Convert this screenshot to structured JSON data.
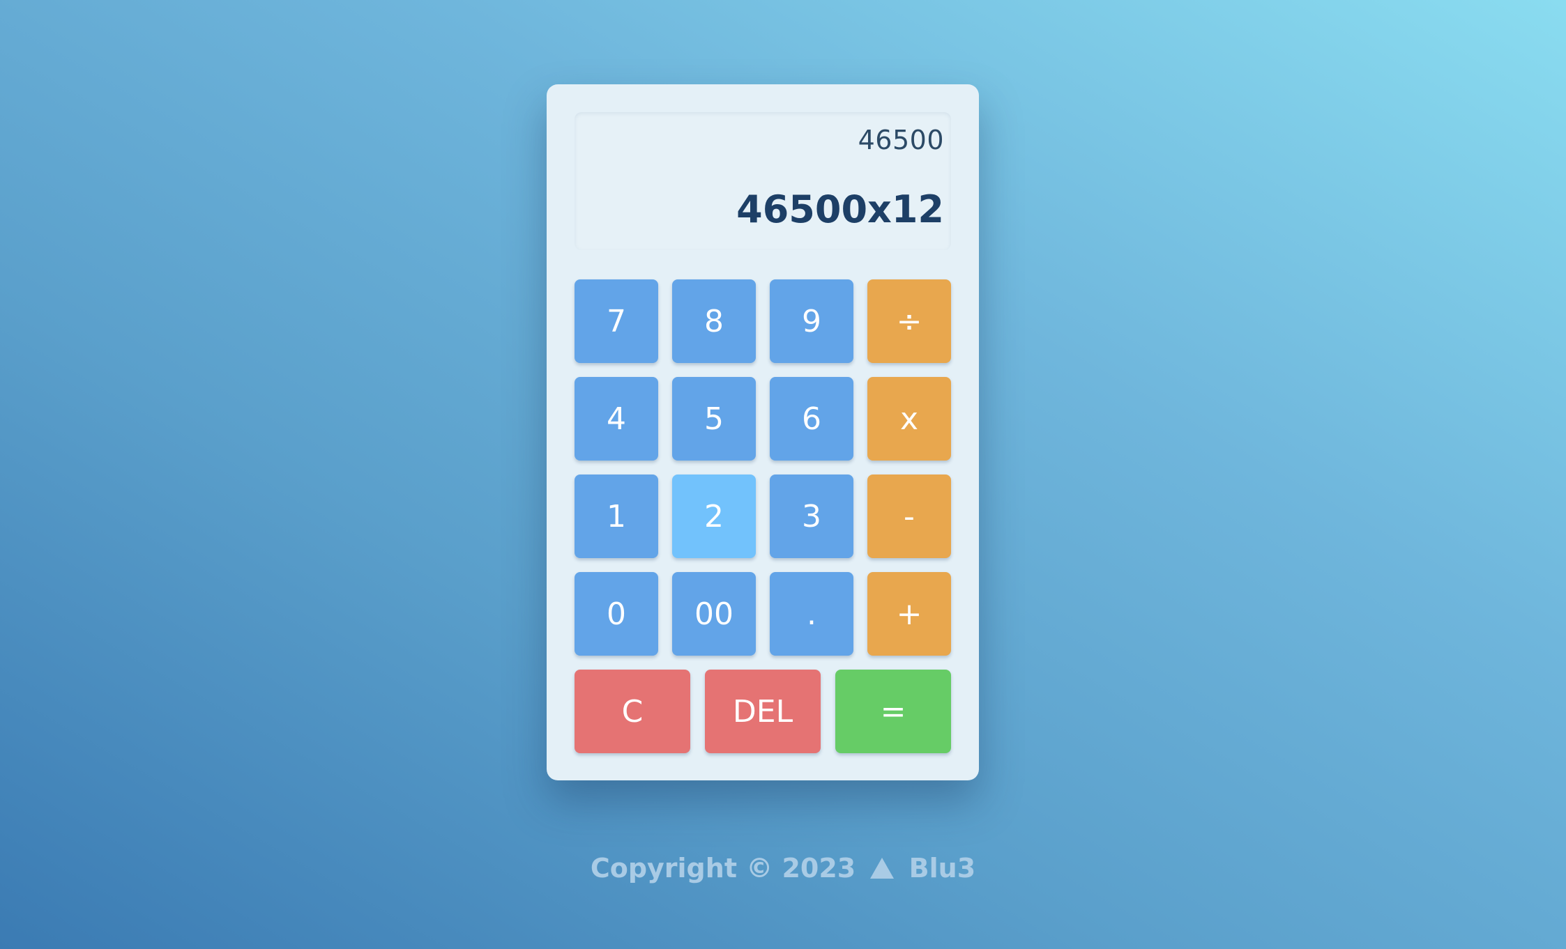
{
  "display": {
    "previous": "46500",
    "current": "46500x12"
  },
  "keys": {
    "seven": "7",
    "eight": "8",
    "nine": "9",
    "divide": "÷",
    "four": "4",
    "five": "5",
    "six": "6",
    "multiply": "x",
    "one": "1",
    "two": "2",
    "three": "3",
    "subtract": "-",
    "zero": "0",
    "double_zero": "00",
    "decimal": ".",
    "add": "+",
    "clear": "C",
    "delete": "DEL",
    "equals": "="
  },
  "footer": {
    "copyright": "Copyright © 2023",
    "brand": "Blu3",
    "logo_icon": "triangle-icon"
  },
  "colors": {
    "number_key": "#62a4e8",
    "number_key_active": "#72c2fc",
    "operator_key": "#e8a74e",
    "clear_key": "#e57373",
    "equals_key": "#66cc66"
  }
}
